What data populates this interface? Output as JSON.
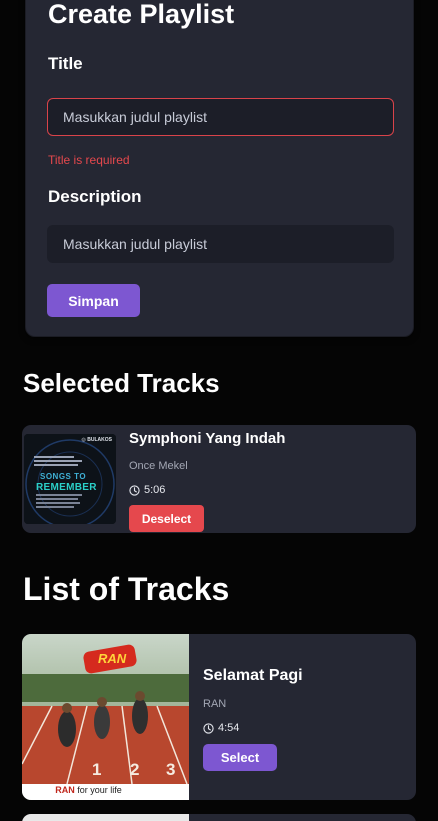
{
  "form": {
    "heading": "Create Playlist",
    "title_label": "Title",
    "title_placeholder": "Masukkan judul playlist",
    "title_error": "Title is required",
    "description_label": "Description",
    "description_placeholder": "Masukkan judul playlist",
    "save_label": "Simpan"
  },
  "selected_section": {
    "heading": "Selected Tracks",
    "tracks": [
      {
        "name": "Symphoni Yang Indah",
        "artist": "Once Mekel",
        "duration": "5:06",
        "action_label": "Deselect",
        "cover": {
          "logo": "◎ BULAKOS",
          "line1": "SONGS TO",
          "line2": "REMEMBER"
        }
      }
    ]
  },
  "list_section": {
    "heading": "List of Tracks",
    "tracks": [
      {
        "name": "Selamat Pagi",
        "artist": "RAN",
        "duration": "4:54",
        "action_label": "Select",
        "cover": {
          "logo": "RAN",
          "lanes": [
            "1",
            "2",
            "3"
          ],
          "caption_bold": "RAN",
          "caption": " for your life"
        }
      }
    ]
  },
  "colors": {
    "background": "#050505",
    "card": "#252733",
    "input": "#1c1e28",
    "accent": "#7d57d1",
    "danger": "#e5484d"
  }
}
